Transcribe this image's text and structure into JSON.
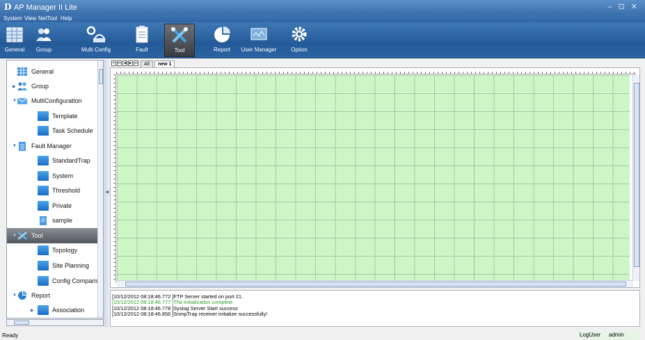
{
  "window": {
    "logo": "D",
    "title": "AP Manager II Lite",
    "controls": "– ⊡ ✕"
  },
  "menu": [
    "System",
    "View",
    "NetTool",
    "Help"
  ],
  "toolbar": [
    {
      "label": "General",
      "icon": "grid-icon"
    },
    {
      "label": "Group",
      "icon": "people-icon"
    },
    {
      "label": "Multi Config",
      "icon": "multi-config-icon"
    },
    {
      "label": "Fault",
      "icon": "clipboard-icon"
    },
    {
      "label": "Tool",
      "icon": "tools-icon",
      "active": true
    },
    {
      "label": "Report",
      "icon": "pie-chart-icon"
    },
    {
      "label": "User Manager",
      "icon": "monitor-icon"
    },
    {
      "label": "Option",
      "icon": "gear-icon"
    }
  ],
  "tree": [
    {
      "label": "General"
    },
    {
      "label": "Group"
    },
    {
      "label": "MultiConfiguration"
    },
    {
      "label": "Template"
    },
    {
      "label": "Task Schedule"
    },
    {
      "label": "Fault Manager"
    },
    {
      "label": "StandardTrap"
    },
    {
      "label": "System"
    },
    {
      "label": "Threshold"
    },
    {
      "label": "Private"
    },
    {
      "label": "sample"
    },
    {
      "label": "Tool",
      "selected": true
    },
    {
      "label": "Topology"
    },
    {
      "label": "Site Planning"
    },
    {
      "label": "Config Comparis"
    },
    {
      "label": "Report"
    },
    {
      "label": "Association"
    }
  ],
  "tabs": {
    "all": "All",
    "active": "new 1"
  },
  "log": [
    {
      "text": "[10/12/2012 08:18:46.772 ]FTP Server started on port 21.",
      "color": "#111111"
    },
    {
      "text": "[10/12/2012 08:18:46.777 ]The initialization complete",
      "color": "#2a9e2a"
    },
    {
      "text": "[10/12/2012 08:18:46.778 ]Syslog Server Start success",
      "color": "#111111"
    },
    {
      "text": "[10/12/2012 08:18:46.856 ]SnmpTrap receiver initialize successfully!",
      "color": "#111111"
    }
  ],
  "status": {
    "ready": "Ready",
    "log_user": "LogUser",
    "user": "admin"
  },
  "colors": {
    "canvas": "#ccf7c5",
    "titlebar": "#3a6eaa",
    "toolbar": "#245a98"
  }
}
